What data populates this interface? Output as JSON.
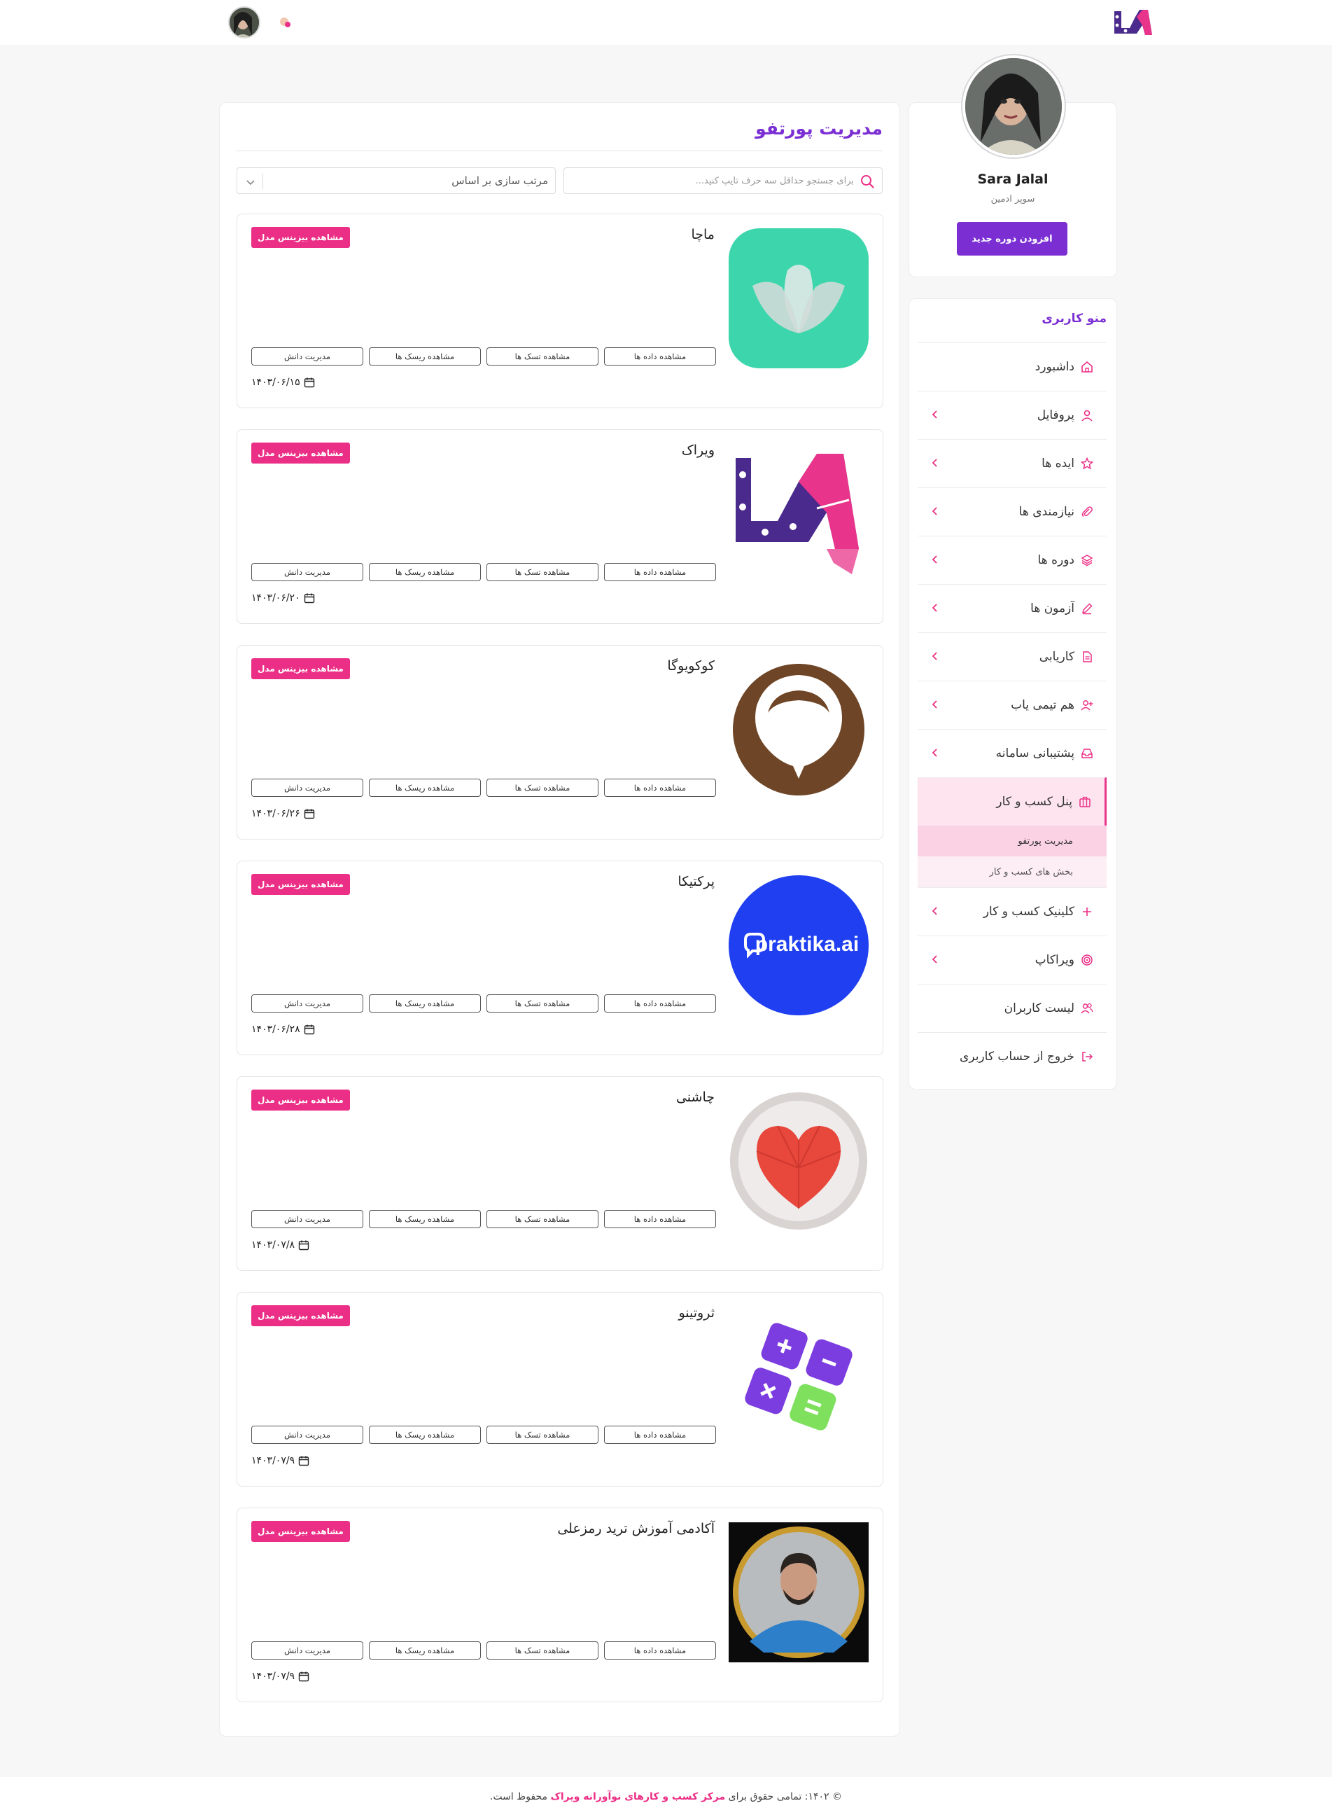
{
  "header": {
    "logo_icon": "viraak-logo",
    "notification_icon": "notification-icon",
    "avatar_icon": "user-avatar"
  },
  "profile": {
    "name": "Sara Jalal",
    "role": "سوپر ادمین",
    "add_course_label": "افزودن دوره جدید"
  },
  "menu": {
    "title": "منو کاربری",
    "items": [
      {
        "label": "داشبورد",
        "icon": "home-icon",
        "has_chevron": false
      },
      {
        "label": "پروفایل",
        "icon": "user-icon",
        "has_chevron": true
      },
      {
        "label": "ایده ها",
        "icon": "star-icon",
        "has_chevron": true
      },
      {
        "label": "نیازمندی ها",
        "icon": "paperclip-icon",
        "has_chevron": true
      },
      {
        "label": "دوره ها",
        "icon": "layers-icon",
        "has_chevron": true
      },
      {
        "label": "آزمون ها",
        "icon": "pencil-icon",
        "has_chevron": true
      },
      {
        "label": "کاریابی",
        "icon": "document-icon",
        "has_chevron": true
      },
      {
        "label": "هم تیمی یاب",
        "icon": "user-plus-icon",
        "has_chevron": true
      },
      {
        "label": "پشتیبانی سامانه",
        "icon": "inbox-icon",
        "has_chevron": true
      },
      {
        "label": "پنل کسب و کار",
        "icon": "briefcase-icon",
        "has_chevron": false,
        "active": true
      },
      {
        "label": "کلینیک کسب و کار",
        "icon": "plus-icon",
        "has_chevron": true
      },
      {
        "label": "ویراکاپ",
        "icon": "target-icon",
        "has_chevron": true
      },
      {
        "label": "لیست کاربران",
        "icon": "users-icon",
        "has_chevron": false
      },
      {
        "label": "خروج از حساب کاربری",
        "icon": "logout-icon",
        "has_chevron": false
      }
    ],
    "submenu": [
      {
        "label": "مدیریت پورتفو",
        "selected": true
      },
      {
        "label": "بخش های کسب و کار",
        "selected": false
      }
    ]
  },
  "main": {
    "title": "مدیریت پورتفو",
    "search_placeholder": "برای جستجو حداقل سه حرف تایپ کنید...",
    "sort_label": "مرتب سازی بر اساس",
    "business_model_label": "مشاهده بیزینس مدل",
    "actions": [
      "مشاهده داده ها",
      "مشاهده تسک ها",
      "مشاهده ریسک ها",
      "مدیریت دانش"
    ],
    "cards": [
      {
        "title": "ماچا",
        "date": "۱۴۰۳/۰۶/۱۵",
        "image": "macha-lotus-logo"
      },
      {
        "title": "ویراک",
        "date": "۱۴۰۳/۰۶/۲۰",
        "image": "viraak-logo"
      },
      {
        "title": "کوکویوگا",
        "date": "۱۴۰۳/۰۶/۲۶",
        "image": "cocoyoga-logo"
      },
      {
        "title": "پرکتیکا",
        "date": "۱۴۰۳/۰۶/۲۸",
        "image": "praktika-logo",
        "image_text": "praktika.ai"
      },
      {
        "title": "چاشنی",
        "date": "۱۴۰۳/۰۷/۸",
        "image": "heart-cake-photo"
      },
      {
        "title": "ثروتینو",
        "date": "۱۴۰۳/۰۷/۹",
        "image": "calculator-keys-icon"
      },
      {
        "title": "آکادمی آموزش ترید رمزعلی",
        "date": "۱۴۰۳/۰۷/۹",
        "image": "trader-portrait-photo"
      }
    ]
  },
  "footer": {
    "prefix": "© ۱۴۰۲: تمامی حقوق برای",
    "brand": "مرکز کسب و کارهای نوآورانه ویراک",
    "suffix": "محفوظ است."
  },
  "colors": {
    "accent_purple": "#7b2fd3",
    "accent_pink": "#ec2f86",
    "macha_green": "#3dd6ac",
    "praktika_blue": "#1f3ff0",
    "cocoyoga_brown": "#6e4526"
  }
}
